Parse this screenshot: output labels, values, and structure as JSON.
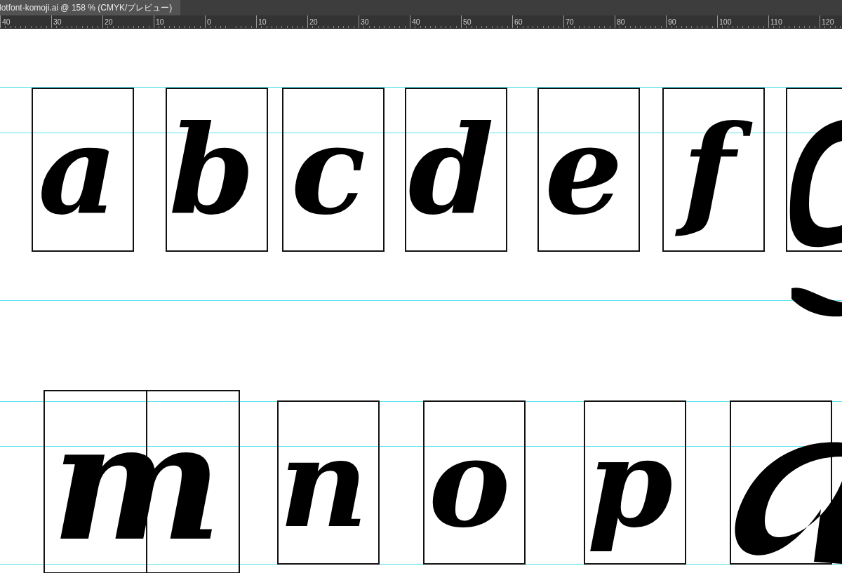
{
  "document_tab": {
    "title": "lotfont-komoji.ai @ 158 % (CMYK/プレビュー)"
  },
  "ruler": {
    "labels": [
      "40",
      "30",
      "20",
      "10",
      "0",
      "10",
      "20",
      "30",
      "40",
      "50",
      "60",
      "70",
      "80",
      "90",
      "100",
      "110",
      "120"
    ]
  },
  "rows": [
    {
      "glyphs": [
        "a",
        "b",
        "c",
        "d",
        "e",
        "f"
      ]
    },
    {
      "glyphs": [
        "m",
        "n",
        "o",
        "p"
      ]
    }
  ]
}
